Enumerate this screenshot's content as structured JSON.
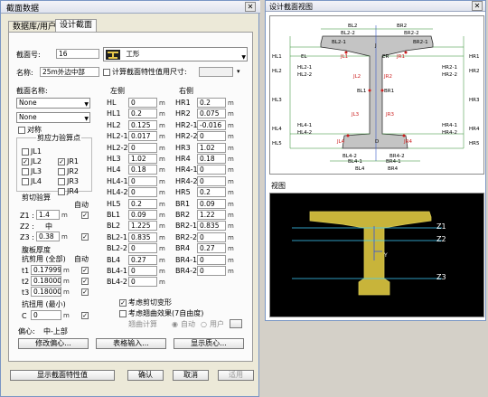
{
  "dialog": {
    "title": "截面数据",
    "close_glyph": "✕"
  },
  "tabs": [
    "数据库/用户",
    "设计截面"
  ],
  "section": {
    "id_label": "截面号:",
    "id_value": "16",
    "shape_name": "工形",
    "name_label": "名称:",
    "name_value": "25m外边中部",
    "check_label": "计算截面特性值用尺寸:"
  },
  "section_name": {
    "label": "截面名称:",
    "sel1": "None",
    "sel2": "None",
    "symmetric_label": "对称"
  },
  "stress_points": {
    "title": "剪应力验算点",
    "left": [
      "JL1",
      "JL2",
      "JL3",
      "JL4"
    ],
    "right": [
      "JR1",
      "JR2",
      "JR3",
      "JR4"
    ]
  },
  "shear": {
    "title": "剪切验算",
    "auto_label": "自动",
    "z1_label": "Z1 :",
    "z1_value": "1.4",
    "z2_label": "Z2 :",
    "z2_value": "中",
    "z3_label": "Z3 :",
    "z3_value": "0.38"
  },
  "web": {
    "title": "腹板厚度",
    "shear_label": "抗剪用 (全部)",
    "auto_label": "自动",
    "t1_label": "t1",
    "t1_value": "0.17999",
    "t2_label": "t2",
    "t2_value": "0.18000",
    "t3_label": "t3",
    "t3_value": "0.18000",
    "torsion_label": "抗扭用 (最小)",
    "c_label": "C",
    "c_value": "0"
  },
  "offset": {
    "label": "偏心:",
    "value": "中-上部"
  },
  "left_col": {
    "header": "左侧",
    "unit": "m",
    "rows": [
      {
        "label": "HL",
        "value": "0"
      },
      {
        "label": "HL1",
        "value": "0.2"
      },
      {
        "label": "HL2",
        "value": "0.125"
      },
      {
        "label": "HL2-1",
        "value": "0.017"
      },
      {
        "label": "HL2-2",
        "value": "0"
      },
      {
        "label": "HL3",
        "value": "1.02"
      },
      {
        "label": "HL4",
        "value": "0.18"
      },
      {
        "label": "HL4-1",
        "value": "0"
      },
      {
        "label": "HL4-2",
        "value": "0"
      },
      {
        "label": "HL5",
        "value": "0.2"
      },
      {
        "label": "BL1",
        "value": "0.09"
      },
      {
        "label": "BL2",
        "value": "1.225"
      },
      {
        "label": "BL2-1",
        "value": "0.835"
      },
      {
        "label": "BL2-2",
        "value": "0"
      },
      {
        "label": "BL4",
        "value": "0.27"
      },
      {
        "label": "BL4-1",
        "value": "0"
      },
      {
        "label": "BL4-2",
        "value": "0"
      }
    ]
  },
  "right_col": {
    "header": "右侧",
    "unit": "m",
    "rows": [
      {
        "label": "HR1",
        "value": "0.2"
      },
      {
        "label": "HR2",
        "value": "0.075"
      },
      {
        "label": "HR2-1",
        "value": "-0.016"
      },
      {
        "label": "HR2-2",
        "value": "0"
      },
      {
        "label": "HR3",
        "value": "1.02"
      },
      {
        "label": "HR4",
        "value": "0.18"
      },
      {
        "label": "HR4-1",
        "value": "0"
      },
      {
        "label": "HR4-2",
        "value": "0"
      },
      {
        "label": "HR5",
        "value": "0.2"
      },
      {
        "label": "BR1",
        "value": "0.09"
      },
      {
        "label": "BR2",
        "value": "1.22"
      },
      {
        "label": "BR2-1",
        "value": "0.835"
      },
      {
        "label": "BR2-2",
        "value": "0"
      },
      {
        "label": "BR4",
        "value": "0.27"
      },
      {
        "label": "BR4-1",
        "value": "0"
      },
      {
        "label": "BR4-2",
        "value": "0"
      }
    ]
  },
  "options": {
    "shear_deform": "考虑剪切变形",
    "warping": "考虑翘曲效果(7自由度)",
    "warp_calc": "翘曲计算",
    "auto": "自动",
    "user": "用户"
  },
  "bottom_buttons": {
    "edit_offset": "修改偏心...",
    "table_input": "表格输入...",
    "show_centroid": "显示质心...",
    "show_props": "显示截面特性值",
    "ok": "确认",
    "cancel": "取消",
    "apply": "适用"
  },
  "design_window": {
    "title": "设计截面视图",
    "dims": {
      "BL2": "BL2",
      "BL2_2": "BL2-2",
      "BL2_1": "BL2-1",
      "BR2": "BR2",
      "BR2_2": "BR2-2",
      "BR2_1": "BR2-1",
      "HL1": "HL1",
      "HL2": "HL2",
      "HL2_1": "HL2-1",
      "HL2_2": "HL2-2",
      "HL3": "HL3",
      "HL4": "HL4",
      "HL4_1": "HL4-1",
      "HL4_2": "HL4-2",
      "HL5": "HL5",
      "HR1": "HR1",
      "HR2": "HR2",
      "HR2_1": "HR2-1",
      "HR2_2": "HR2-2",
      "HR3": "HR3",
      "HR4": "HR4",
      "HR4_1": "HR4-1",
      "HR4_2": "HR4-2",
      "HR5": "HR5",
      "JL1": "JL1",
      "JR1": "JR1",
      "JL2": "JL2",
      "JR2": "JR2",
      "JL3": "JL3",
      "JR3": "JR3",
      "JL4": "JL4",
      "JR4": "JR4",
      "BL1": "BL1",
      "BR1": "BR1",
      "BL4": "BL4",
      "BR4": "BR4",
      "BL4_1": "BL4-1",
      "BL4_2": "BL4-2",
      "BR4_1": "BR4-1",
      "BR4_2": "BR4-2",
      "EL": "EL",
      "ER": "ER",
      "J": "J",
      "D": "D"
    }
  },
  "preview": {
    "title": "视图",
    "z1": "Z1",
    "z2": "Z2",
    "z3": "Z3",
    "y": "Y",
    "colors": {
      "bg": "#000000",
      "section": "#c8b43a",
      "line": "#3fd0ff"
    }
  }
}
